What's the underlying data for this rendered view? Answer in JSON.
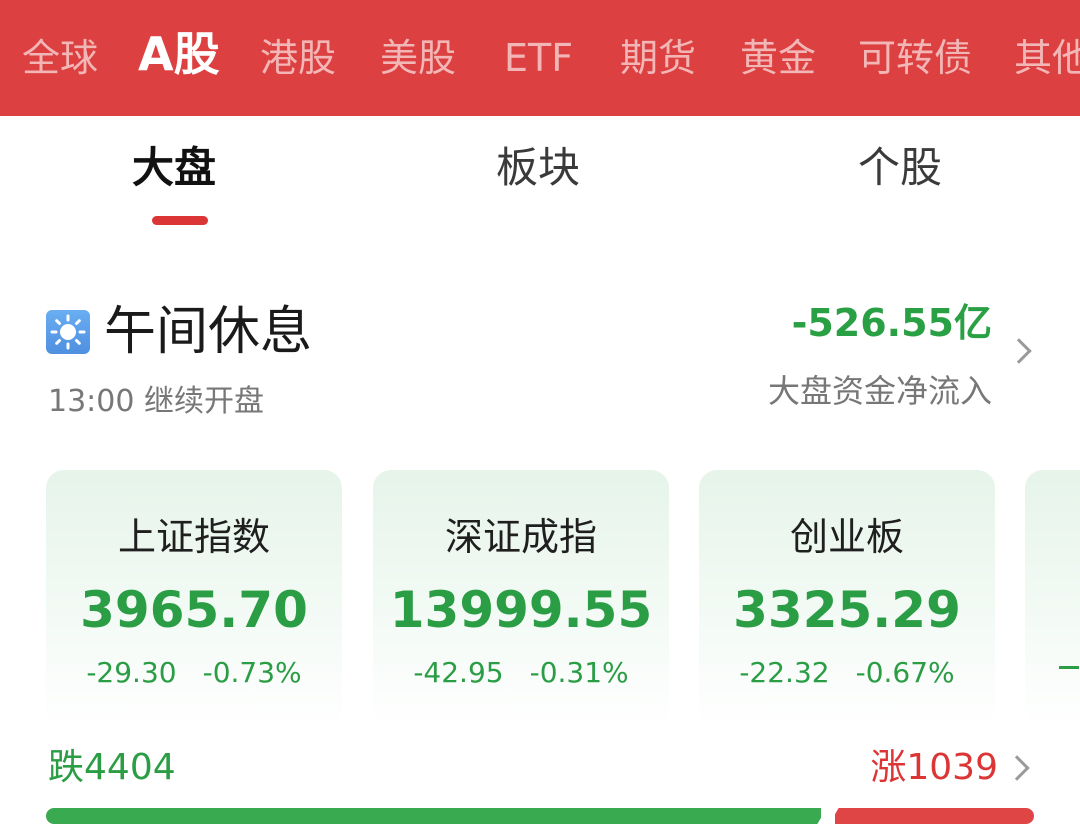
{
  "market_tabs": [
    {
      "label": "全球"
    },
    {
      "label": "A股",
      "active": true
    },
    {
      "label": "港股"
    },
    {
      "label": "美股"
    },
    {
      "label": "ETF"
    },
    {
      "label": "期货"
    },
    {
      "label": "黄金"
    },
    {
      "label": "可转债"
    },
    {
      "label": "其他"
    }
  ],
  "sub_tabs": [
    {
      "label": "大盘",
      "active": true
    },
    {
      "label": "板块"
    },
    {
      "label": "个股"
    }
  ],
  "status": {
    "icon": "sun-icon",
    "title": "午间休息",
    "subtitle": "13:00 继续开盘"
  },
  "capital_flow": {
    "value": "-526.55亿",
    "label": "大盘资金净流入"
  },
  "indices": [
    {
      "name": "上证指数",
      "value": "3965.70",
      "change": "-29.30",
      "change_pct": "-0.73%"
    },
    {
      "name": "深证成指",
      "value": "13999.55",
      "change": "-42.95",
      "change_pct": "-0.31%"
    },
    {
      "name": "创业板",
      "value": "3325.29",
      "change": "-22.32",
      "change_pct": "-0.67%"
    }
  ],
  "breadth": {
    "down_label": "跌",
    "down_count": "4404",
    "up_label": "涨",
    "up_count": "1039",
    "down_fraction": 0.791
  },
  "colors": {
    "brand_red": "#dc4040",
    "down_green": "#2a9d45",
    "up_red": "#dc3535",
    "sun_icon_bg": "#5a9ce8"
  }
}
